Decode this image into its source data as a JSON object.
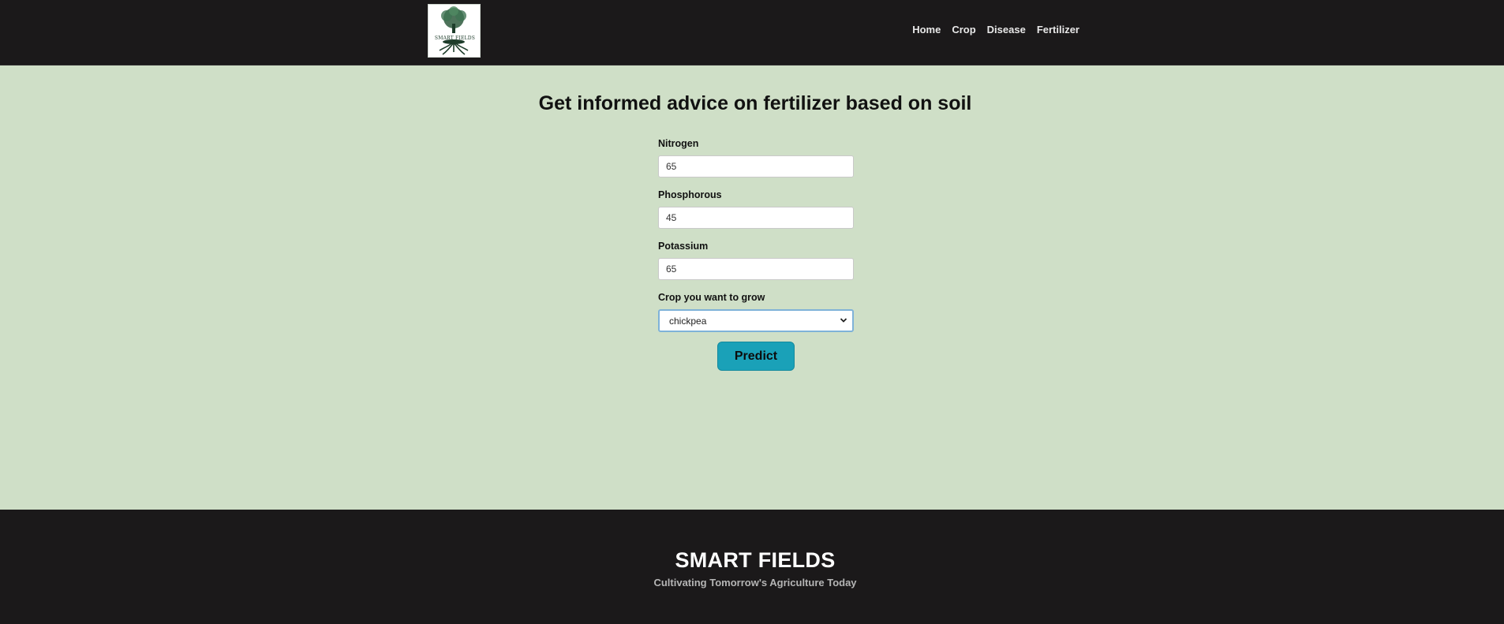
{
  "header": {
    "logo_text": "SMART FIELDS",
    "nav": [
      {
        "label": "Home"
      },
      {
        "label": "Crop"
      },
      {
        "label": "Disease"
      },
      {
        "label": "Fertilizer"
      }
    ]
  },
  "main": {
    "title": "Get informed advice on fertilizer based on soil",
    "form": {
      "nitrogen": {
        "label": "Nitrogen",
        "value": "65"
      },
      "phosphorous": {
        "label": "Phosphorous",
        "value": "45"
      },
      "potassium": {
        "label": "Potassium",
        "value": "65"
      },
      "crop": {
        "label": "Crop you want to grow",
        "selected": "chickpea"
      },
      "submit_label": "Predict"
    }
  },
  "footer": {
    "title": "SMART FIELDS",
    "tagline": "Cultivating Tomorrow's Agriculture Today"
  },
  "colors": {
    "header_bg": "#1b191a",
    "main_bg": "#cfdfc7",
    "button_bg": "#1aa1b8",
    "logo_green": "#1e3d2b"
  },
  "icons": {
    "logo": "tree-roots-icon",
    "select_arrow": "chevron-down-icon"
  }
}
